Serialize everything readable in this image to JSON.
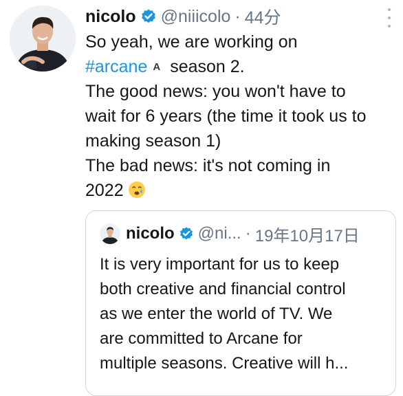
{
  "tweet": {
    "author_name": "nicolo",
    "handle": "@niiicolo",
    "separator": "·",
    "time": "44分",
    "more_icon": "more-vertical-icon",
    "verified_icon": "verified-badge-icon",
    "body_lines": {
      "line1": "So yeah, we are working on",
      "hashtag": "#arcane",
      "hashtag_emoji": "A",
      "line2_rest": "season 2.",
      "line3": "The good news: you won't have to",
      "line4": "wait for 6 years (the time it took us to",
      "line5": "making season 1)",
      "line6": "The bad news: it's not coming in",
      "line7": "2022"
    },
    "emoji_icon": "crying-face-emoji"
  },
  "quoted_tweet": {
    "author_name": "nicolo",
    "handle": "@ni...",
    "separator": "·",
    "date": "19年10月17日",
    "body_lines": [
      "It is very important for us to keep",
      "both creative and financial control",
      "as we enter the world of TV. We",
      "are committed to Arcane for",
      "multiple seasons. Creative will h..."
    ]
  },
  "colors": {
    "accent": "#1b95e0",
    "text": "#14171a",
    "secondary": "#657786",
    "border": "#ccd6dd"
  }
}
